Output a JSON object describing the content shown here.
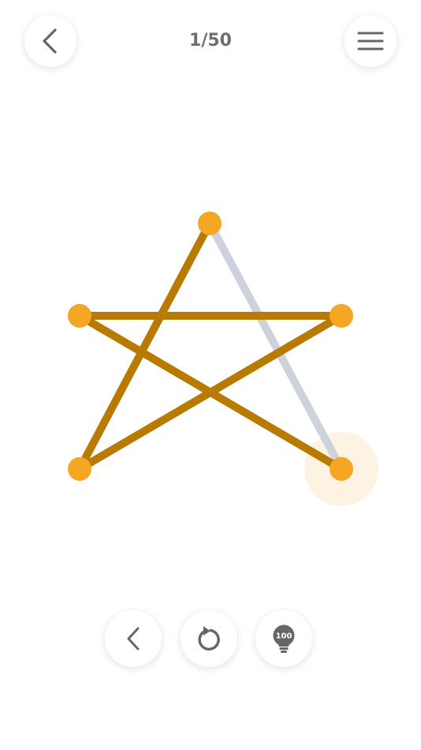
{
  "header": {
    "level": "1/50"
  },
  "game": {
    "nodes": [
      {
        "id": "top"
      },
      {
        "id": "left-mid"
      },
      {
        "id": "right-mid"
      },
      {
        "id": "bottom-left"
      },
      {
        "id": "bottom-right"
      }
    ],
    "colors": {
      "drawn_line": "#b87a00",
      "pending_line": "#cdd2dc",
      "node": "#f5a623",
      "active_glow": "#fdf3e3"
    }
  },
  "toolbar": {
    "hint_cost": "100"
  }
}
